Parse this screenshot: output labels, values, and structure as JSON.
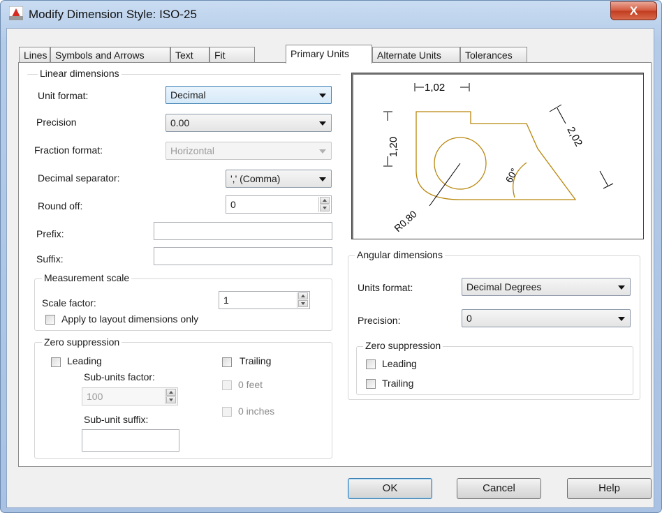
{
  "window": {
    "title": "Modify Dimension Style: ISO-25",
    "close_label": "X"
  },
  "tabs": [
    {
      "label": "Lines"
    },
    {
      "label": "Symbols and Arrows"
    },
    {
      "label": "Text"
    },
    {
      "label": "Fit"
    },
    {
      "label": "Primary Units",
      "active": true
    },
    {
      "label": "Alternate Units"
    },
    {
      "label": "Tolerances"
    }
  ],
  "linear": {
    "group_title": "Linear dimensions",
    "unit_format_label": "Unit format:",
    "unit_format_value": "Decimal",
    "precision_label": "Precision",
    "precision_value": "0.00",
    "fraction_format_label": "Fraction format:",
    "fraction_format_value": "Horizontal",
    "decimal_separator_label": "Decimal separator:",
    "decimal_separator_value": "',' (Comma)",
    "round_off_label": "Round off:",
    "round_off_value": "0",
    "prefix_label": "Prefix:",
    "prefix_value": "",
    "suffix_label": "Suffix:",
    "suffix_value": ""
  },
  "measurement": {
    "group_title": "Measurement scale",
    "scale_factor_label": "Scale factor:",
    "scale_factor_value": "1",
    "apply_layout_label": "Apply to layout dimensions only",
    "apply_layout_checked": false
  },
  "zero_linear": {
    "group_title": "Zero suppression",
    "leading_label": "Leading",
    "trailing_label": "Trailing",
    "sub_units_factor_label": "Sub-units factor:",
    "sub_units_factor_value": "100",
    "sub_unit_suffix_label": "Sub-unit suffix:",
    "sub_unit_suffix_value": "",
    "zero_feet_label": "0 feet",
    "zero_inches_label": "0 inches"
  },
  "preview": {
    "dim_top": "1,02",
    "dim_left": "1,20",
    "dim_diag": "2,02",
    "dim_angle": "60°",
    "dim_radius": "R0,80",
    "line_color": "#b8860b"
  },
  "angular": {
    "group_title": "Angular dimensions",
    "units_format_label": "Units format:",
    "units_format_value": "Decimal Degrees",
    "precision_label": "Precision:",
    "precision_value": "0"
  },
  "zero_angular": {
    "group_title": "Zero suppression",
    "leading_label": "Leading",
    "trailing_label": "Trailing"
  },
  "buttons": {
    "ok": "OK",
    "cancel": "Cancel",
    "help": "Help"
  }
}
